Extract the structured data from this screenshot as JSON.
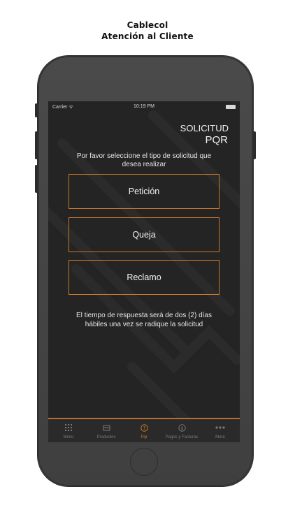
{
  "caption": {
    "line1": "Cablecol",
    "line2": "Atención al Cliente"
  },
  "statusbar": {
    "carrier": "Carrier ᯤ",
    "time": "10:19 PM"
  },
  "header": {
    "title_line1": "SOLICITUD",
    "title_line2": "PQR"
  },
  "prompt": "Por favor seleccione el tipo de solicitud que desea realizar",
  "options": [
    {
      "label": "Petición"
    },
    {
      "label": "Queja"
    },
    {
      "label": "Reclamo"
    }
  ],
  "note": "El tiempo de respuesta será de dos (2) días hábiles una vez se radique la solicitud",
  "tabbar": {
    "items": [
      {
        "label": "Menu",
        "icon": "grid-icon"
      },
      {
        "label": "Productos",
        "icon": "box-icon"
      },
      {
        "label": "Pqr",
        "icon": "question-circle-icon",
        "active": true
      },
      {
        "label": "Pagos y Facturas",
        "icon": "coin-icon"
      },
      {
        "label": "More",
        "icon": "more-dots-icon"
      }
    ]
  },
  "colors": {
    "accent": "#c8782a",
    "screen_bg": "#242424",
    "phone_body": "#454545",
    "text": "#f2f2f2"
  }
}
